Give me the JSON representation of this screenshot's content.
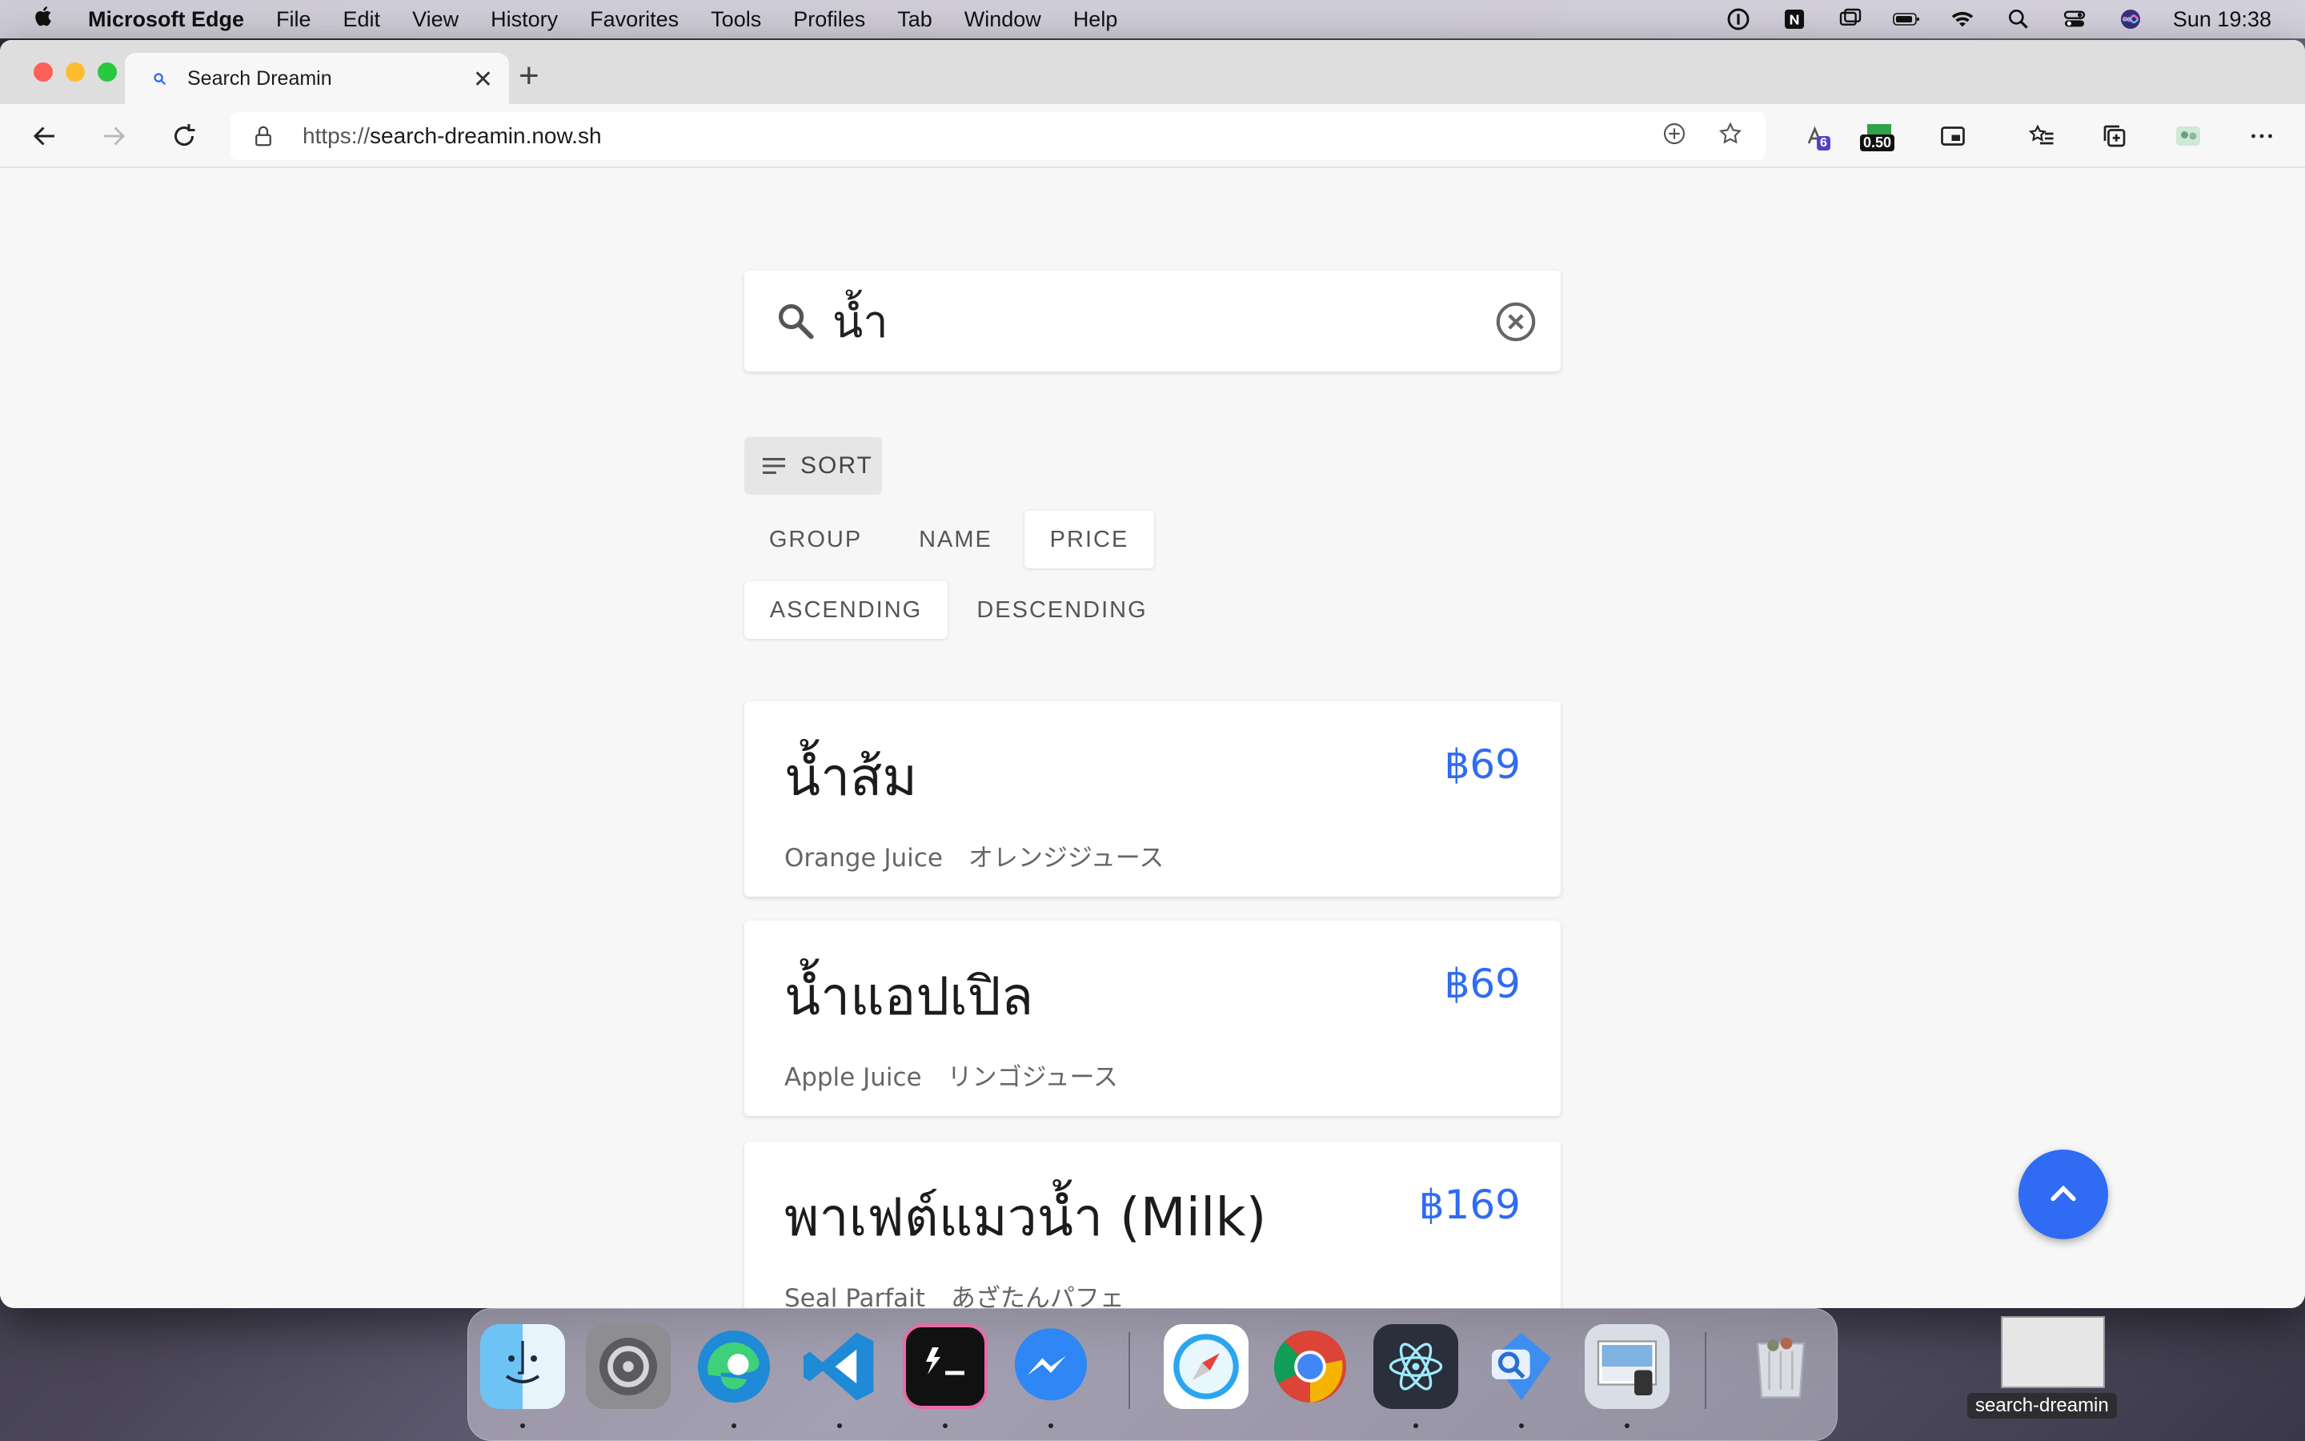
{
  "menubar": {
    "app_name": "Microsoft Edge",
    "items": [
      "File",
      "Edit",
      "View",
      "History",
      "Favorites",
      "Tools",
      "Profiles",
      "Tab",
      "Window",
      "Help"
    ],
    "clock": "Sun 19:38"
  },
  "browser": {
    "tab_title": "Search Dreamin",
    "new_tab_label": "+",
    "url_protocol": "https://",
    "url_host": "search-dreamin.now.sh",
    "ext_badge_count": "6",
    "ext_badge_value": "0.50"
  },
  "search": {
    "query": "น้ำ"
  },
  "sort": {
    "label": "SORT",
    "fields": [
      "GROUP",
      "NAME",
      "PRICE"
    ],
    "active_field": "PRICE",
    "orders": [
      "ASCENDING",
      "DESCENDING"
    ],
    "active_order": "ASCENDING"
  },
  "results": [
    {
      "name": "น้ำส้ม",
      "price": "฿69",
      "en": "Orange Juice",
      "ja": "オレンジジュース"
    },
    {
      "name": "น้ำแอปเปิล",
      "price": "฿69",
      "en": "Apple Juice",
      "ja": "リンゴジュース"
    },
    {
      "name": "พาเฟต์แมวน้ำ (Milk)",
      "price": "฿169",
      "en": "Seal Parfait",
      "ja": "あざたんパフェ"
    }
  ],
  "dock": {
    "hover_label": "search-dreamin",
    "apps": [
      "finder-icon",
      "system-preferences-icon",
      "edge-icon",
      "vscode-icon",
      "terminal-icon",
      "messenger-icon",
      "safari-icon",
      "chrome-icon",
      "electron-icon",
      "finder-search-icon",
      "preview-icon",
      "trash-icon"
    ]
  },
  "colors": {
    "accent": "#2f6bf3",
    "page_bg": "#f7f7f7"
  }
}
